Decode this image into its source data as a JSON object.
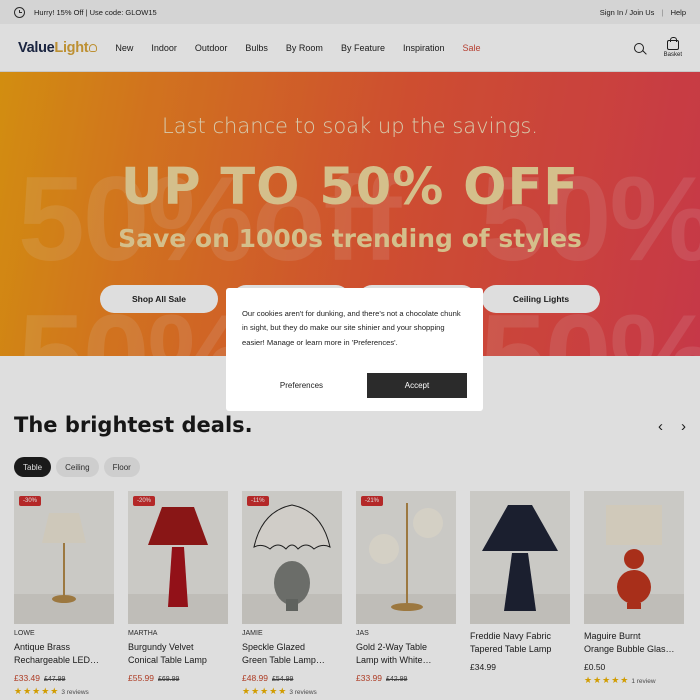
{
  "promo": {
    "message": "Hurry! 15% Off | Use code: GLOW15",
    "sign_in": "Sign In",
    "join_us": "Join Us",
    "help": "Help"
  },
  "header": {
    "logo_part1": "Value",
    "logo_part2": "Light",
    "nav": [
      "New",
      "Indoor",
      "Outdoor",
      "Bulbs",
      "By Room",
      "By Feature",
      "Inspiration",
      "Sale"
    ],
    "basket_label": "Basket"
  },
  "hero": {
    "subtitle": "Last chance to soak up the savings.",
    "headline": "UP TO 50% OFF",
    "tagline": "Save on 1000s trending of styles",
    "bg_text": "50%off",
    "buttons": [
      "Shop All Sale",
      "",
      "",
      "Ceiling Lights"
    ]
  },
  "deals": {
    "title": "The brightest deals.",
    "prev_arrow": "‹",
    "next_arrow": "›",
    "tabs": [
      "Table",
      "Ceiling",
      "Floor"
    ],
    "products": [
      {
        "badge": "-30%",
        "brand": "LOWE",
        "name1": "Antique Brass",
        "name2": "Rechargeable LED…",
        "price": "£33.49",
        "was": "£47.99",
        "stars": "★★★★★",
        "reviews": "3 reviews"
      },
      {
        "badge": "-20%",
        "brand": "MARTHA",
        "name1": "Burgundy Velvet",
        "name2": "Conical Table Lamp",
        "price": "£55.99",
        "was": "£69.99",
        "stars": "",
        "reviews": ""
      },
      {
        "badge": "-11%",
        "brand": "JAMIE",
        "name1": "Speckle Glazed",
        "name2": "Green Table Lamp…",
        "price": "£48.99",
        "was": "£54.99",
        "stars": "★★★★★",
        "reviews": "3 reviews"
      },
      {
        "badge": "-21%",
        "brand": "JAS",
        "name1": "Gold 2-Way Table",
        "name2": "Lamp with White…",
        "price": "£33.99",
        "was": "£42.99",
        "stars": "",
        "reviews": ""
      },
      {
        "badge": "",
        "brand": "",
        "name1": "Freddie Navy Fabric",
        "name2": "Tapered Table Lamp",
        "price": "£34.99",
        "was": "",
        "stars": "",
        "reviews": ""
      },
      {
        "badge": "",
        "brand": "",
        "name1": "Maguire Burnt",
        "name2": "Orange Bubble Glas…",
        "price": "£0.50",
        "was": "",
        "stars": "★★★★★",
        "reviews": "1 review"
      }
    ]
  },
  "cookie": {
    "text": "Our cookies aren't for dunking, and there's not a chocolate chunk in sight, but they do make our site shinier and your shopping easier! Manage or learn more in 'Preferences'.",
    "preferences": "Preferences",
    "accept": "Accept"
  }
}
